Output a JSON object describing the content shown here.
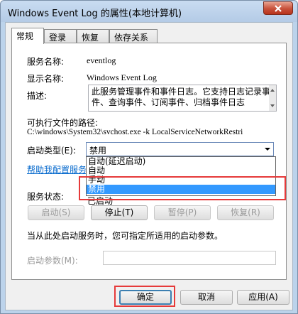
{
  "window": {
    "title": "Windows Event Log 的属性(本地计算机)",
    "close_symbol": "✕"
  },
  "tabs": [
    {
      "label": "常规",
      "active": true
    },
    {
      "label": "登录",
      "active": false
    },
    {
      "label": "恢复",
      "active": false
    },
    {
      "label": "依存关系",
      "active": false
    }
  ],
  "general": {
    "service_name_label": "服务名称:",
    "service_name_value": "eventlog",
    "display_name_label": "显示名称:",
    "display_name_value": "Windows Event Log",
    "description_label": "描述:",
    "description_value": "此服务管理事件和事件日志。它支持日志记录事件、查询事件、订阅事件、归档事件日志",
    "exe_path_label": "可执行文件的路径:",
    "exe_path_value": "C:\\windows\\System32\\svchost.exe -k LocalServiceNetworkRestri",
    "startup_type_label": "启动类型(E):",
    "startup_type_value": "禁用",
    "startup_options": [
      {
        "label": "自动(延迟启动)",
        "selected": false
      },
      {
        "label": "自动",
        "selected": false
      },
      {
        "label": "手动",
        "selected": false
      },
      {
        "label": "禁用",
        "selected": true
      }
    ],
    "help_link": "帮助我配置服务启动",
    "service_status_label": "服务状态:",
    "service_status_value": "已启动"
  },
  "service_buttons": {
    "start": "启动(S)",
    "stop": "停止(T)",
    "pause": "暂停(P)",
    "resume": "恢复(R)"
  },
  "hint_text": "当从此处启动服务时，您可指定所适用的启动参数。",
  "start_params_label": "启动参数(M):",
  "start_params_value": "",
  "dialog_buttons": {
    "ok": "确定",
    "cancel": "取消",
    "apply": "应用(A)"
  },
  "colors": {
    "highlight_box": "#e63a3a",
    "selection": "#3399ff",
    "link": "#0066cc"
  }
}
